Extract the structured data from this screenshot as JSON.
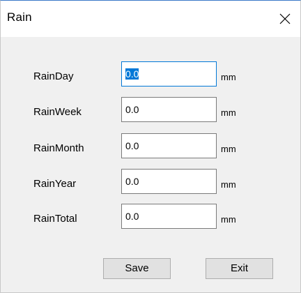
{
  "window": {
    "title": "Rain"
  },
  "fields": [
    {
      "label": "RainDay",
      "value": "0.0",
      "unit": "mm",
      "focused": true
    },
    {
      "label": "RainWeek",
      "value": "0.0",
      "unit": "mm"
    },
    {
      "label": "RainMonth",
      "value": "0.0",
      "unit": "mm"
    },
    {
      "label": "RainYear",
      "value": "0.0",
      "unit": "mm"
    },
    {
      "label": "RainTotal",
      "value": "0.0",
      "unit": "mm"
    }
  ],
  "buttons": {
    "save_label": "Save",
    "exit_label": "Exit"
  },
  "icons": {
    "close": "close-icon"
  },
  "colors": {
    "title_bar_accent": "#3a78c8",
    "focus_border": "#0078d7",
    "selection": "#0078d7",
    "dialog_bg": "#f0f0f0"
  }
}
